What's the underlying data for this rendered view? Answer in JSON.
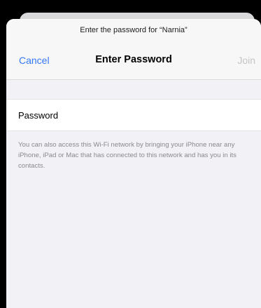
{
  "sheet": {
    "prompt": "Enter the password for “Narnia”",
    "title": "Enter Password",
    "cancel_label": "Cancel",
    "join_label": "Join"
  },
  "form": {
    "password_label": "Password",
    "password_value": "",
    "footnote": "You can also access this Wi-Fi network by bringing your iPhone near any iPhone, iPad or Mac that has connected to this network and has you in its contacts."
  },
  "colors": {
    "accent": "#3478f6",
    "disabled": "#c4c4c8",
    "background": "#f1f1f6"
  }
}
